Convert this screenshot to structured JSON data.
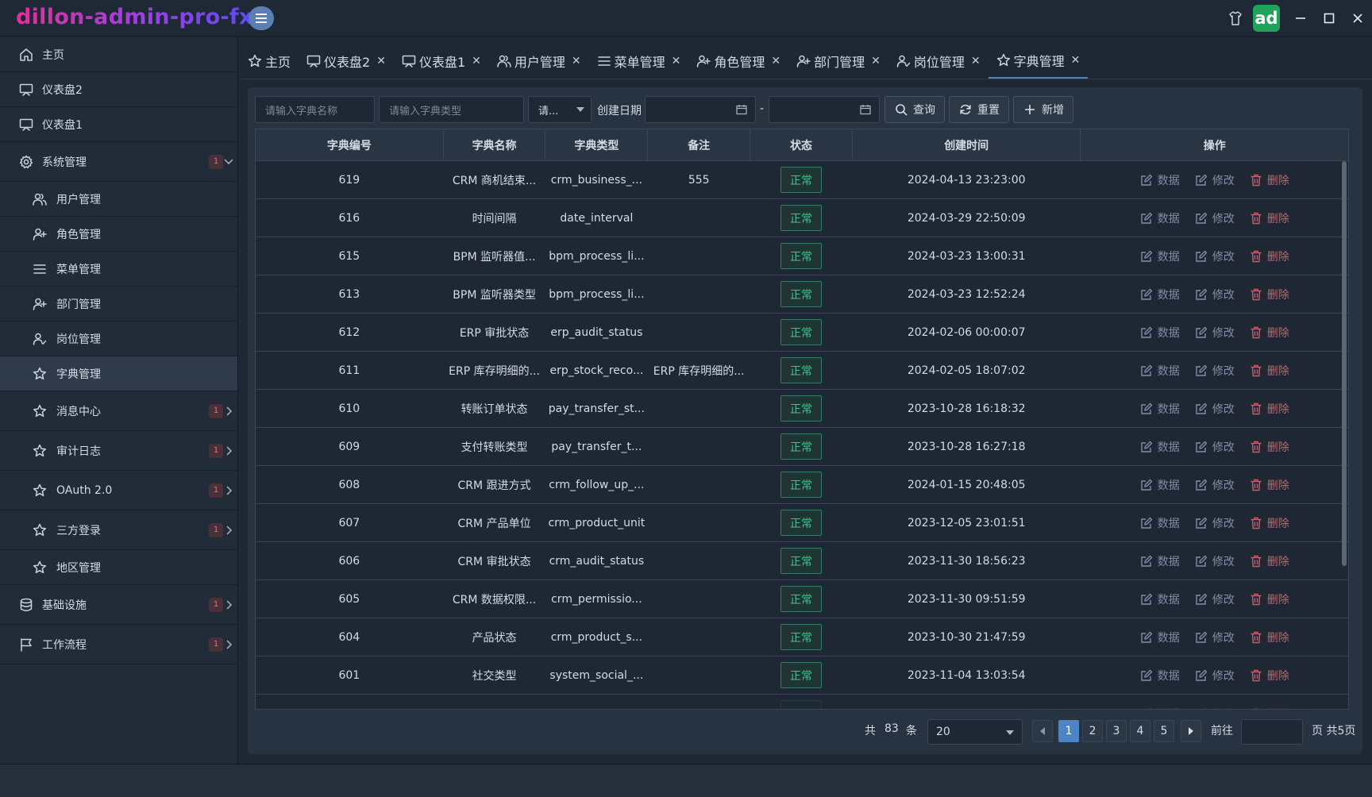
{
  "app": {
    "title": "dillon-admin-pro-fx",
    "avatar_text": "ad"
  },
  "sidebar": {
    "items": [
      {
        "label": "主页",
        "icon": "home-icon",
        "level": 0
      },
      {
        "label": "仪表盘2",
        "icon": "monitor-icon",
        "level": 0
      },
      {
        "label": "仪表盘1",
        "icon": "monitor-icon",
        "level": 0
      },
      {
        "label": "系统管理",
        "icon": "gear-icon",
        "level": 0,
        "badge": "1",
        "expanded": true
      },
      {
        "label": "用户管理",
        "icon": "users-icon",
        "level": 1
      },
      {
        "label": "角色管理",
        "icon": "user-plus-icon",
        "level": 1
      },
      {
        "label": "菜单管理",
        "icon": "list-icon",
        "level": 1
      },
      {
        "label": "部门管理",
        "icon": "user-plus-icon",
        "level": 1
      },
      {
        "label": "岗位管理",
        "icon": "user-check-icon",
        "level": 1
      },
      {
        "label": "字典管理",
        "icon": "star-icon",
        "level": 1,
        "active": true
      },
      {
        "label": "消息中心",
        "icon": "star-icon",
        "level": 1,
        "badge": "1",
        "expanded": false
      },
      {
        "label": "审计日志",
        "icon": "star-icon",
        "level": 1,
        "badge": "1",
        "expanded": false
      },
      {
        "label": "OAuth 2.0",
        "icon": "star-icon",
        "level": 1,
        "badge": "1",
        "expanded": false
      },
      {
        "label": "三方登录",
        "icon": "star-icon",
        "level": 1,
        "badge": "1",
        "expanded": false
      },
      {
        "label": "地区管理",
        "icon": "star-icon",
        "level": 1
      },
      {
        "label": "基础设施",
        "icon": "database-icon",
        "level": 0,
        "badge": "1",
        "expanded": false
      },
      {
        "label": "工作流程",
        "icon": "flag-icon",
        "level": 0,
        "badge": "1",
        "expanded": false
      }
    ]
  },
  "tabs": [
    {
      "label": "主页",
      "icon": "star-icon",
      "closable": false
    },
    {
      "label": "仪表盘2",
      "icon": "monitor-icon",
      "closable": true
    },
    {
      "label": "仪表盘1",
      "icon": "monitor-icon",
      "closable": true
    },
    {
      "label": "用户管理",
      "icon": "users-icon",
      "closable": true
    },
    {
      "label": "菜单管理",
      "icon": "list-icon",
      "closable": true
    },
    {
      "label": "角色管理",
      "icon": "user-plus-icon",
      "closable": true
    },
    {
      "label": "部门管理",
      "icon": "user-plus-icon",
      "closable": true
    },
    {
      "label": "岗位管理",
      "icon": "user-check-icon",
      "closable": true
    },
    {
      "label": "字典管理",
      "icon": "star-icon",
      "closable": true,
      "active": true
    }
  ],
  "search": {
    "name_placeholder": "请输入字典名称",
    "type_placeholder": "请输入字典类型",
    "status_select": "请...",
    "date_label": "创建日期",
    "date_separator": "-",
    "query_label": "查询",
    "reset_label": "重置",
    "add_label": "新增"
  },
  "table": {
    "columns": [
      "字典编号",
      "字典名称",
      "字典类型",
      "备注",
      "状态",
      "创建时间",
      "操作"
    ],
    "actions": {
      "data": "数据",
      "edit": "修改",
      "delete": "删除"
    },
    "rows": [
      {
        "id": "619",
        "name": "CRM 商机结束...",
        "type": "crm_business_...",
        "remark": "555",
        "status": "正常",
        "created": "2024-04-13 23:23:00"
      },
      {
        "id": "616",
        "name": "时间间隔",
        "type": "date_interval",
        "remark": "",
        "status": "正常",
        "created": "2024-03-29 22:50:09"
      },
      {
        "id": "615",
        "name": "BPM 监听器值...",
        "type": "bpm_process_li...",
        "remark": "",
        "status": "正常",
        "created": "2024-03-23 13:00:31"
      },
      {
        "id": "613",
        "name": "BPM 监听器类型",
        "type": "bpm_process_li...",
        "remark": "",
        "status": "正常",
        "created": "2024-03-23 12:52:24"
      },
      {
        "id": "612",
        "name": "ERP 审批状态",
        "type": "erp_audit_status",
        "remark": "",
        "status": "正常",
        "created": "2024-02-06 00:00:07"
      },
      {
        "id": "611",
        "name": "ERP 库存明细的...",
        "type": "erp_stock_reco...",
        "remark": "ERP 库存明细的...",
        "status": "正常",
        "created": "2024-02-05 18:07:02"
      },
      {
        "id": "610",
        "name": "转账订单状态",
        "type": "pay_transfer_st...",
        "remark": "",
        "status": "正常",
        "created": "2023-10-28 16:18:32"
      },
      {
        "id": "609",
        "name": "支付转账类型",
        "type": "pay_transfer_t...",
        "remark": "",
        "status": "正常",
        "created": "2023-10-28 16:27:18"
      },
      {
        "id": "608",
        "name": "CRM 跟进方式",
        "type": "crm_follow_up_...",
        "remark": "",
        "status": "正常",
        "created": "2024-01-15 20:48:05"
      },
      {
        "id": "607",
        "name": "CRM 产品单位",
        "type": "crm_product_unit",
        "remark": "",
        "status": "正常",
        "created": "2023-12-05 23:01:51"
      },
      {
        "id": "606",
        "name": "CRM 审批状态",
        "type": "crm_audit_status",
        "remark": "",
        "status": "正常",
        "created": "2023-11-30 18:56:23"
      },
      {
        "id": "605",
        "name": "CRM 数据权限...",
        "type": "crm_permissio...",
        "remark": "",
        "status": "正常",
        "created": "2023-11-30 09:51:59"
      },
      {
        "id": "604",
        "name": "产品状态",
        "type": "crm_product_s...",
        "remark": "",
        "status": "正常",
        "created": "2023-10-30 21:47:59"
      },
      {
        "id": "601",
        "name": "社交类型",
        "type": "system_social_...",
        "remark": "",
        "status": "正常",
        "created": "2023-11-04 13:03:54"
      }
    ]
  },
  "pagination": {
    "total_prefix": "共",
    "total": "83",
    "total_suffix": "条",
    "page_size": "20",
    "pages": [
      "1",
      "2",
      "3",
      "4",
      "5"
    ],
    "current": "1",
    "goto_label": "前往",
    "page_suffix": "页 共5页"
  },
  "colors": {
    "accent": "#4d83c7",
    "status_ok": "#54b894",
    "danger": "#c0656c",
    "avatar": "#1fa35a"
  }
}
